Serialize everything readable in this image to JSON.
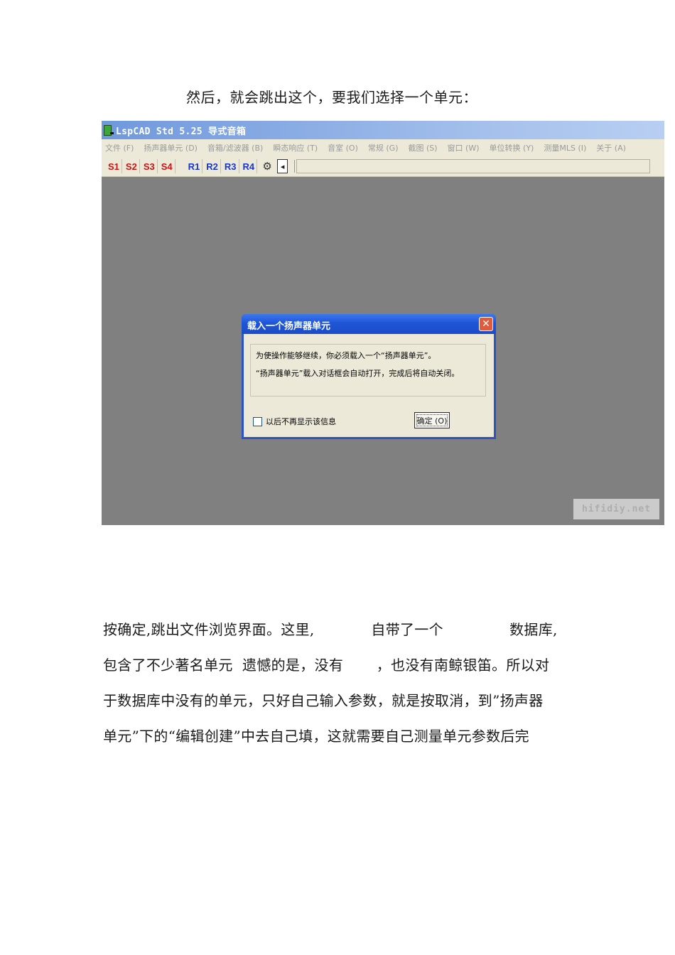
{
  "intro": "然后，就会跳出这个，要我们选择一个单元：",
  "app": {
    "title": "LspCAD Std 5.25 导式音箱",
    "menu": [
      "文件 (F)",
      "扬声器单元 (D)",
      "音箱/滤波器 (B)",
      "瞬态响应 (T)",
      "音室 (O)",
      "常规 (G)",
      "截图 (S)",
      "窗口 (W)",
      "单位转换 (Y)",
      "测量MLS (I)",
      "关于 (A)"
    ],
    "toolbar": {
      "s_buttons": [
        "S1",
        "S2",
        "S3",
        "S4"
      ],
      "r_buttons": [
        "R1",
        "R2",
        "R3",
        "R4"
      ]
    },
    "dialog": {
      "title": "载入一个扬声器单元",
      "close": "✕",
      "message1": "为使操作能够继续，你必须载入一个“扬声器单元”。",
      "message2": "“扬声器单元”载入对话框会自动打开，完成后将自动关闭。",
      "checkbox_label": "以后不再显示该信息",
      "ok_label": "确定 (O)"
    },
    "watermark": "hifidiy.net"
  },
  "paragraph": [
    "按确定,跳出文件浏览界面。这里,            自带了一个              数据库,",
    "包含了不少著名单元  遗憾的是，没有       ，也没有南鲸银笛。所以对",
    "于数据库中没有的单元，只好自己输入参数，就是按取消，到”扬声器",
    "单元”下的“编辑创建”中去自己填，这就需要自己测量单元参数后完"
  ]
}
